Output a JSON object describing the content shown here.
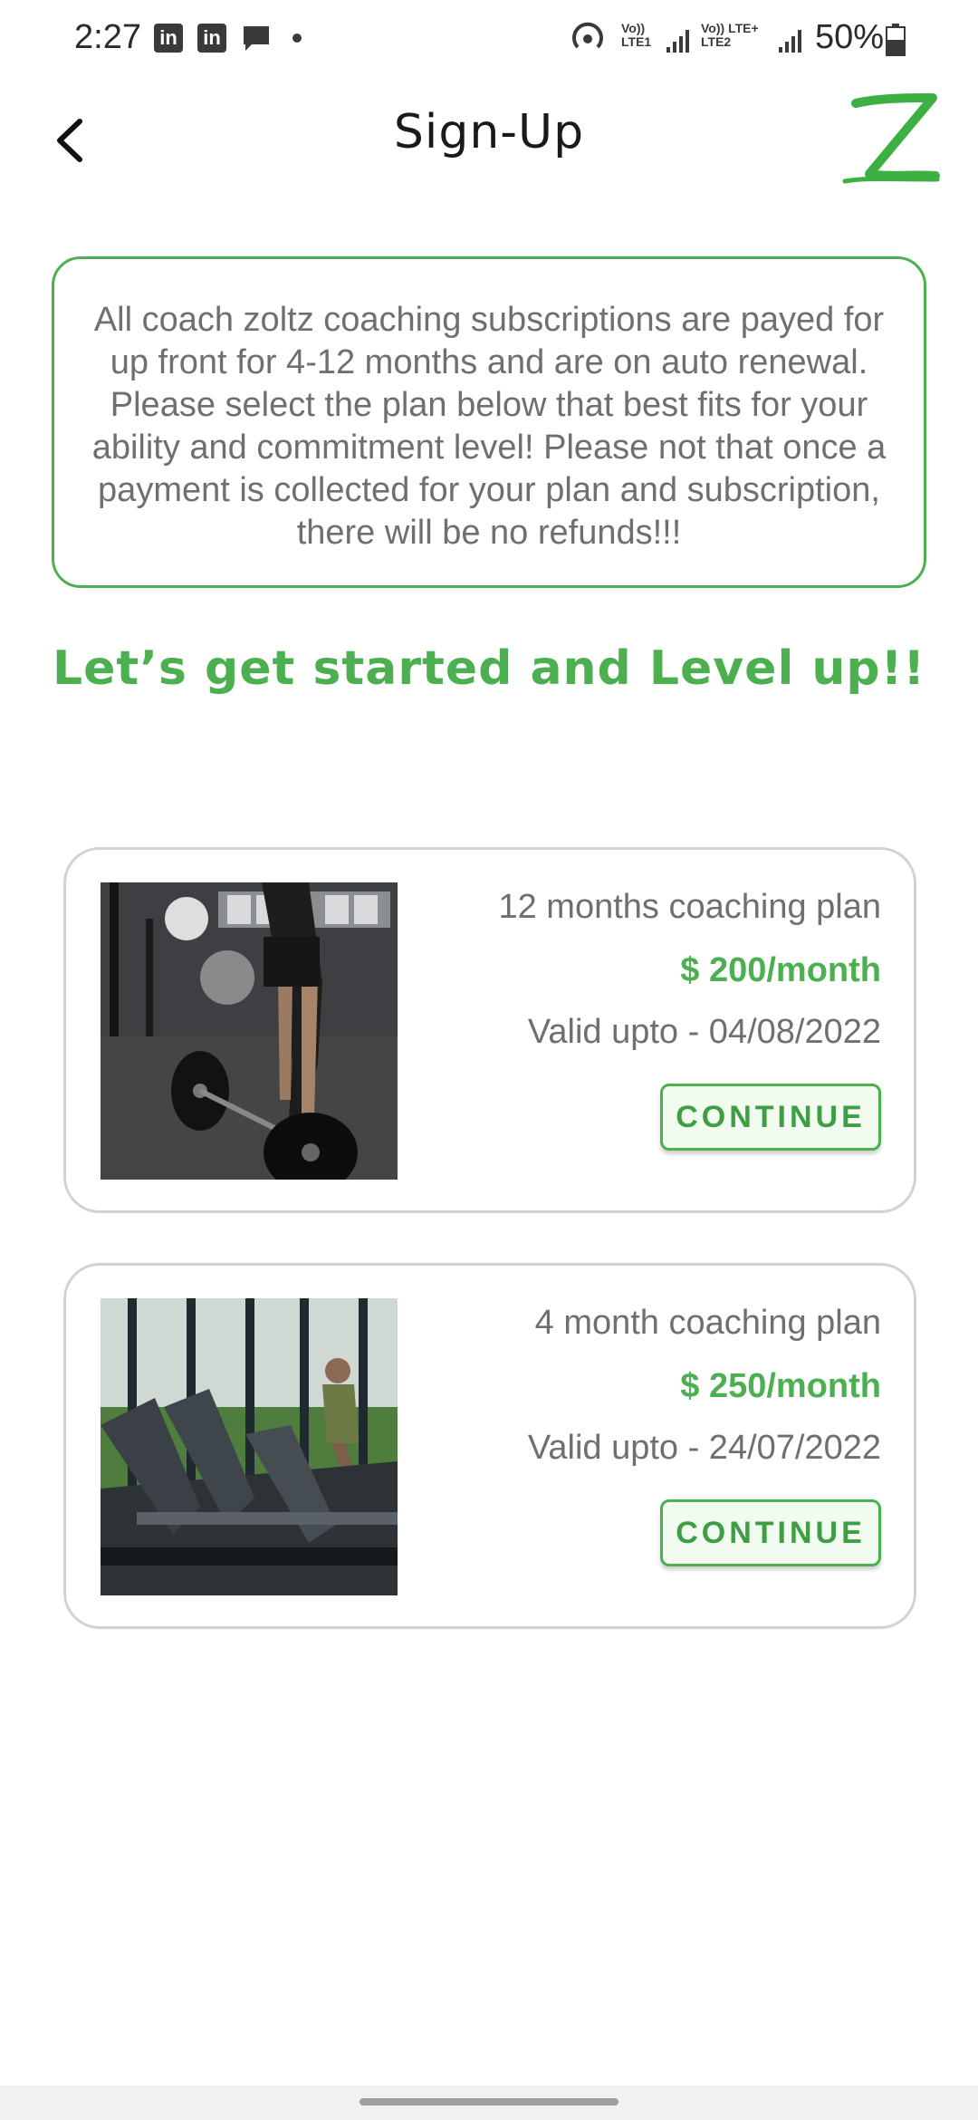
{
  "status_bar": {
    "time": "2:27",
    "notification_icons": [
      "linkedin-icon",
      "linkedin-icon",
      "message-icon"
    ],
    "sim1": {
      "top": "Vo))",
      "bottom": "LTE1"
    },
    "sim2": {
      "top": "Vo)) LTE+",
      "bottom": "LTE2"
    },
    "battery": "50%"
  },
  "header": {
    "title": "Sign-Up",
    "back_icon": "chevron-left-icon",
    "logo_icon": "z-logo-icon"
  },
  "info": {
    "text": "All coach zoltz coaching subscriptions are payed for up front for 4-12 months and are on auto renewal. Please select the plan below that best fits for your ability and commitment level! Please not that once a payment is collected for your plan and subscription, there will be no refunds!!!"
  },
  "tagline": "Let’s get started and Level up!!",
  "plans": [
    {
      "name": "12 months coaching plan",
      "price": "$ 200/month",
      "valid": "Valid upto - 04/08/2022",
      "button": "CONTINUE",
      "image": "barbell-gym-photo"
    },
    {
      "name": "4 month coaching plan",
      "price": "$ 250/month",
      "valid": "Valid upto - 24/07/2022",
      "button": "CONTINUE",
      "image": "treadmill-gym-photo"
    }
  ],
  "colors": {
    "accent": "#4caf50",
    "text_gray": "#6f6f6f",
    "card_border": "#d2d2d2"
  }
}
